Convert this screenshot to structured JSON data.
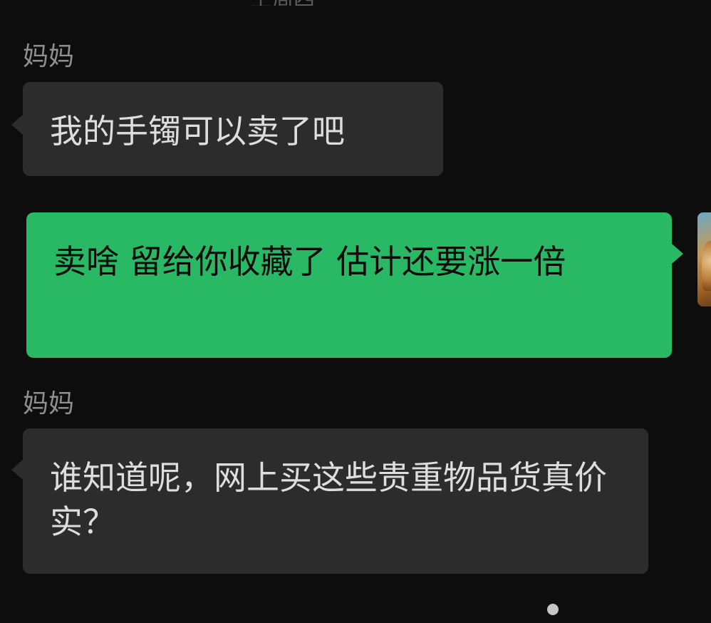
{
  "chat": {
    "top_partial_text": "上周四",
    "messages": [
      {
        "sender": "妈妈",
        "direction": "incoming",
        "text": "我的手镯可以卖了吧"
      },
      {
        "sender": "",
        "direction": "outgoing",
        "text": "卖啥 留给你收藏了 估计还要涨一倍"
      },
      {
        "sender": "妈妈",
        "direction": "incoming",
        "text": "谁知道呢，网上买这些贵重物品货真价实？"
      }
    ]
  },
  "colors": {
    "background": "#0d0d0d",
    "incoming_bubble": "#2c2c2c",
    "outgoing_bubble": "#29b864",
    "sender_name": "#8f8f8f"
  },
  "icons": {
    "avatar": "user-avatar-photo",
    "watermark": "watermark-logo"
  }
}
